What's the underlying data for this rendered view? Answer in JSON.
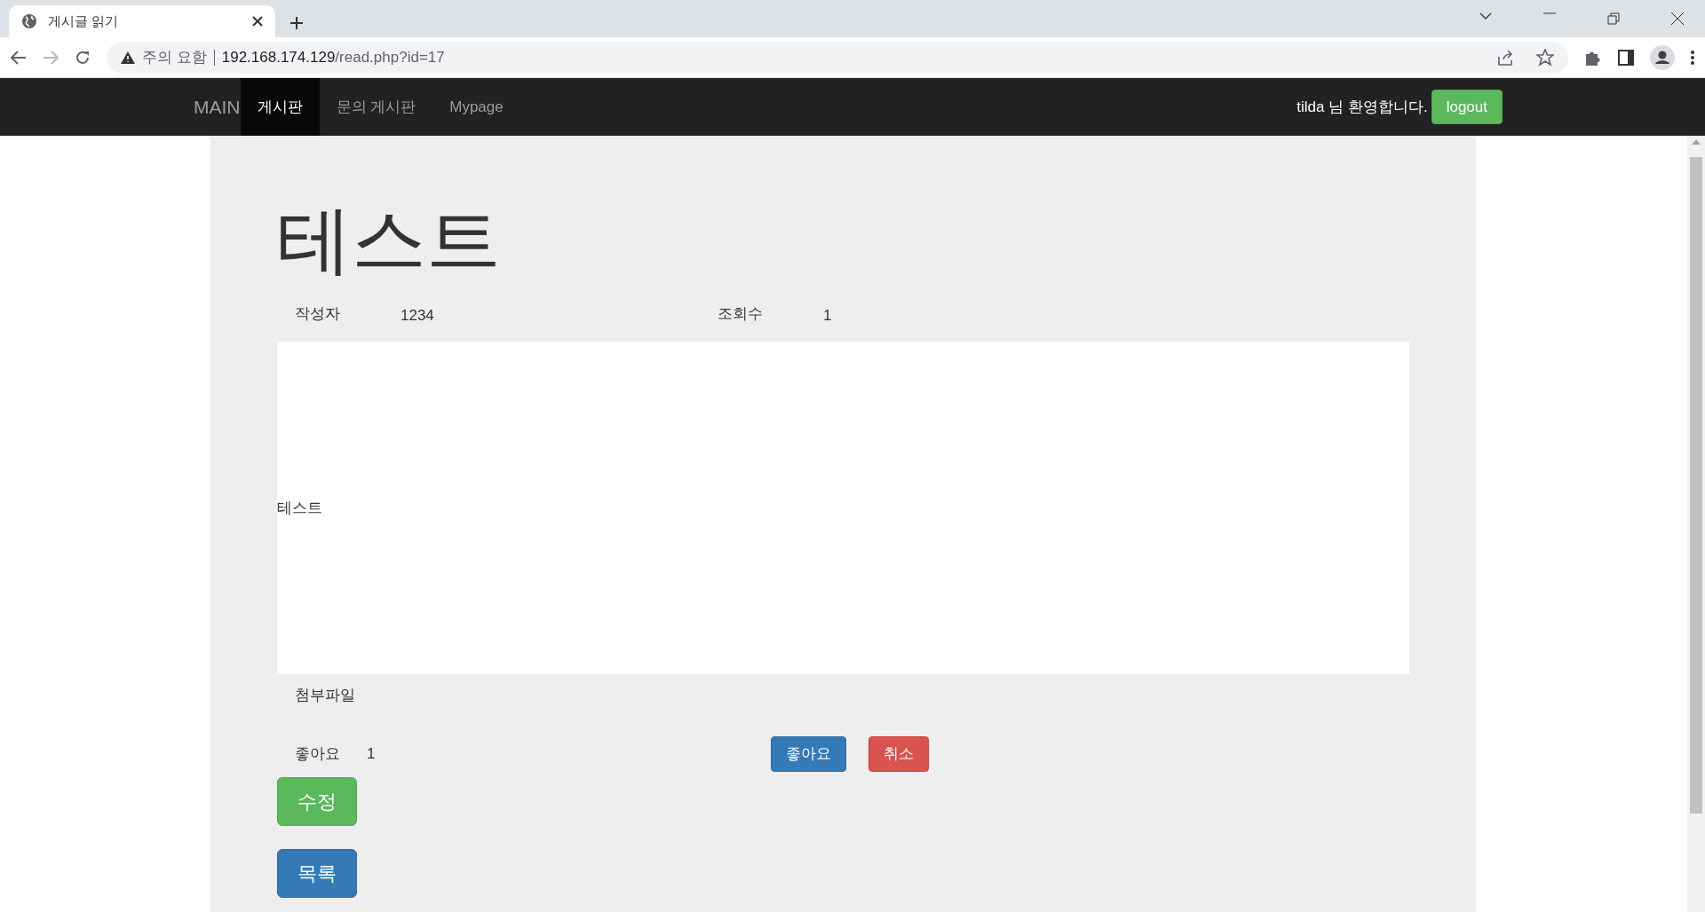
{
  "browser": {
    "tab_title": "게시글 읽기",
    "security_label": "주의 요함",
    "url_host": "192.168.174.129",
    "url_path": "/read.php?id=17"
  },
  "navbar": {
    "brand": "MAIN",
    "items": [
      {
        "label": "게시판",
        "selected": true
      },
      {
        "label": "문의 게시판",
        "selected": false
      },
      {
        "label": "Mypage",
        "selected": false
      }
    ],
    "user": "tilda",
    "welcome": "님 환영합니다.",
    "logout": "logout"
  },
  "post": {
    "title": "테스트",
    "meta": [
      {
        "label": "작성자",
        "value": "1234"
      },
      {
        "label": "조회수",
        "value": "1"
      }
    ],
    "body": "테스트",
    "attachment_label": "첨부파일",
    "likes_label": "좋아요",
    "likes_count": "1",
    "like_button": "좋아요",
    "cancel_button": "취소",
    "edit_button": "수정",
    "list_button": "목록"
  }
}
